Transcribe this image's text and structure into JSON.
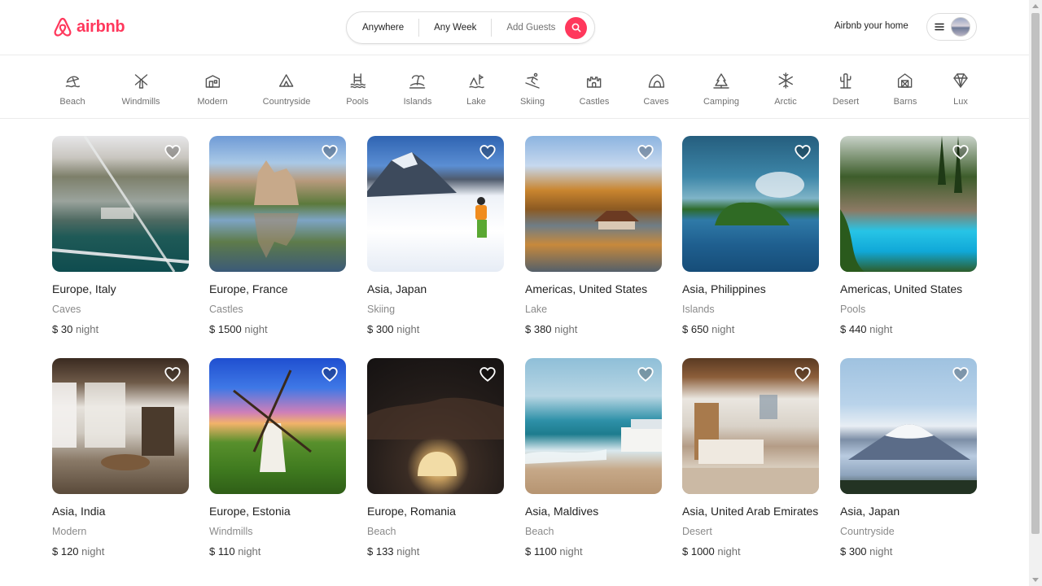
{
  "brand": {
    "name": "airbnb",
    "color": "#ff385c"
  },
  "search": {
    "where": "Anywhere",
    "when": "Any Week",
    "who": "Add Guests",
    "button_icon": "search-icon"
  },
  "header": {
    "host_link": "Airbnb your home",
    "menu_icon": "hamburger-icon",
    "avatar_icon": "avatar"
  },
  "categories": [
    {
      "label": "Beach",
      "icon": "beach-icon"
    },
    {
      "label": "Windmills",
      "icon": "windmill-icon"
    },
    {
      "label": "Modern",
      "icon": "modern-house-icon"
    },
    {
      "label": "Countryside",
      "icon": "countryside-icon"
    },
    {
      "label": "Pools",
      "icon": "pool-icon"
    },
    {
      "label": "Islands",
      "icon": "island-icon"
    },
    {
      "label": "Lake",
      "icon": "lake-icon"
    },
    {
      "label": "Skiing",
      "icon": "skiing-icon"
    },
    {
      "label": "Castles",
      "icon": "castle-icon"
    },
    {
      "label": "Caves",
      "icon": "cave-icon"
    },
    {
      "label": "Camping",
      "icon": "camping-icon"
    },
    {
      "label": "Arctic",
      "icon": "snowflake-icon"
    },
    {
      "label": "Desert",
      "icon": "cactus-icon"
    },
    {
      "label": "Barns",
      "icon": "barn-icon"
    },
    {
      "label": "Lux",
      "icon": "diamond-icon"
    }
  ],
  "listings": [
    {
      "location": "Europe, Italy",
      "category": "Caves",
      "price": "$ 30",
      "unit": "night"
    },
    {
      "location": "Europe, France",
      "category": "Castles",
      "price": "$ 1500",
      "unit": "night"
    },
    {
      "location": "Asia, Japan",
      "category": "Skiing",
      "price": "$ 300",
      "unit": "night"
    },
    {
      "location": "Americas, United States",
      "category": "Lake",
      "price": "$ 380",
      "unit": "night"
    },
    {
      "location": "Asia, Philippines",
      "category": "Islands",
      "price": "$ 650",
      "unit": "night"
    },
    {
      "location": "Americas, United States",
      "category": "Pools",
      "price": "$ 440",
      "unit": "night"
    },
    {
      "location": "Asia, India",
      "category": "Modern",
      "price": "$ 120",
      "unit": "night"
    },
    {
      "location": "Europe, Estonia",
      "category": "Windmills",
      "price": "$ 110",
      "unit": "night"
    },
    {
      "location": "Europe, Romania",
      "category": "Beach",
      "price": "$ 133",
      "unit": "night"
    },
    {
      "location": "Asia, Maldives",
      "category": "Beach",
      "price": "$ 1100",
      "unit": "night"
    },
    {
      "location": "Asia, United Arab Emirates",
      "category": "Desert",
      "price": "$ 1000",
      "unit": "night"
    },
    {
      "location": "Asia, Japan",
      "category": "Countryside",
      "price": "$ 300",
      "unit": "night"
    }
  ]
}
